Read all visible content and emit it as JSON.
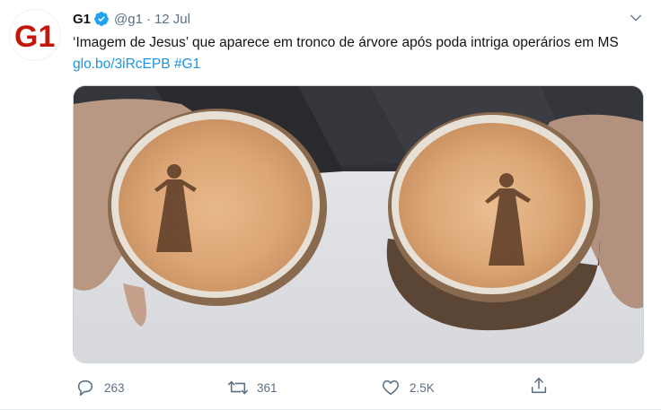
{
  "tweet": {
    "avatar_logo_text": "G1",
    "display_name": "G1",
    "handle": "@g1",
    "separator": "·",
    "timestamp": "12 Jul",
    "text_main": "‘Imagem de Jesus’ que aparece em tronco de árvore após poda intriga operários em MS",
    "link": "glo.bo/3iRcEPB",
    "hashtag": "#G1"
  },
  "media": {
    "icon": "photo-of-two-tree-trunk-slices-with-figure"
  },
  "actions": {
    "reply_count": "263",
    "retweet_count": "361",
    "like_count": "2.5K"
  },
  "colors": {
    "brand_red": "#c4170c",
    "link_blue": "#1b95e0",
    "verified_blue": "#1da1f2",
    "secondary_text": "#5b7083"
  }
}
